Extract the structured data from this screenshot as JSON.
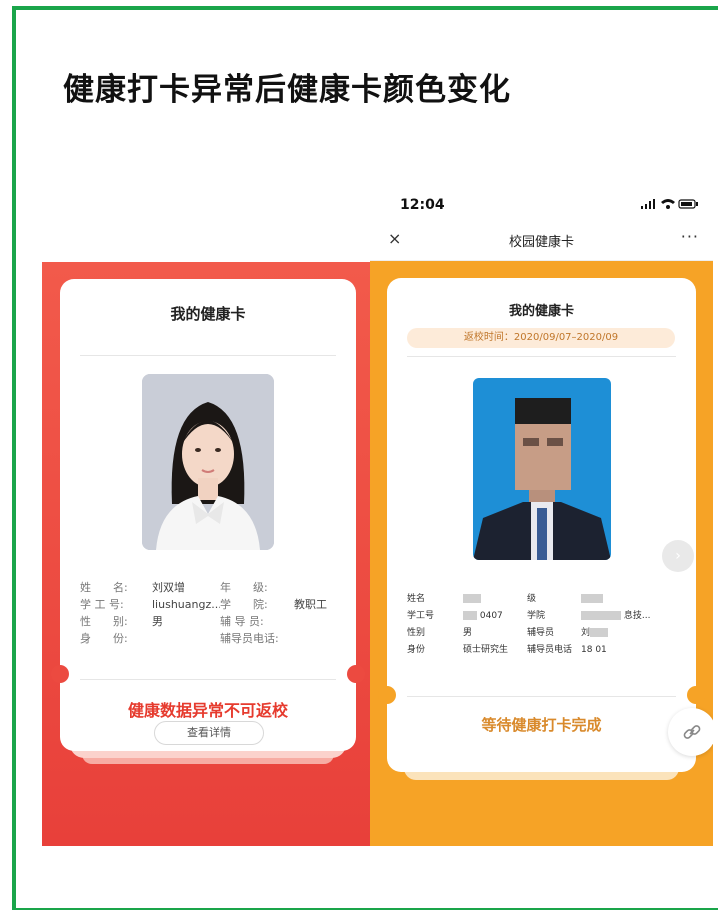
{
  "page": {
    "title": "健康打卡异常后健康卡颜色变化"
  },
  "left_card": {
    "title": "我的健康卡",
    "rows": [
      {
        "l1": "姓　　名:",
        "v1": "刘双增",
        "l2": "年　　级:",
        "v2": ""
      },
      {
        "l1": "学 工 号:",
        "v1": "liushuangz...",
        "l2": "学　　院:",
        "v2": "教职工"
      },
      {
        "l1": "性　　别:",
        "v1": "男",
        "l2": "辅 导 员:",
        "v2": ""
      },
      {
        "l1": "身　　份:",
        "v1": "",
        "l2": "辅导员电话:",
        "v2": ""
      }
    ],
    "warning": "健康数据异常不可返校",
    "detail_button": "查看详情",
    "colors": {
      "primary": "#e8403a",
      "warning": "#e63b2e"
    }
  },
  "right_phone": {
    "time": "12:04",
    "status_icons": "signal-wifi-battery",
    "nav_close": "×",
    "nav_title": "校园健康卡",
    "nav_more": "···",
    "card_title": "我的健康卡",
    "return_time": "返校时间：2020/09/07–2020/09",
    "rows": [
      {
        "l1": "姓名",
        "v1": "",
        "l2": "级",
        "v2": ""
      },
      {
        "l1": "学工号",
        "v1": "0407",
        "l2": "学院",
        "v2": "息技..."
      },
      {
        "l1": "性别",
        "v1": "男",
        "l2": "辅导员",
        "v2": "刘"
      },
      {
        "l1": "身份",
        "v1": "硕士研究生",
        "l2": "辅导员电话",
        "v2": "18 01"
      }
    ],
    "status_text": "等待健康打卡完成",
    "colors": {
      "primary": "#f6a326",
      "status": "#d98a2c"
    }
  }
}
